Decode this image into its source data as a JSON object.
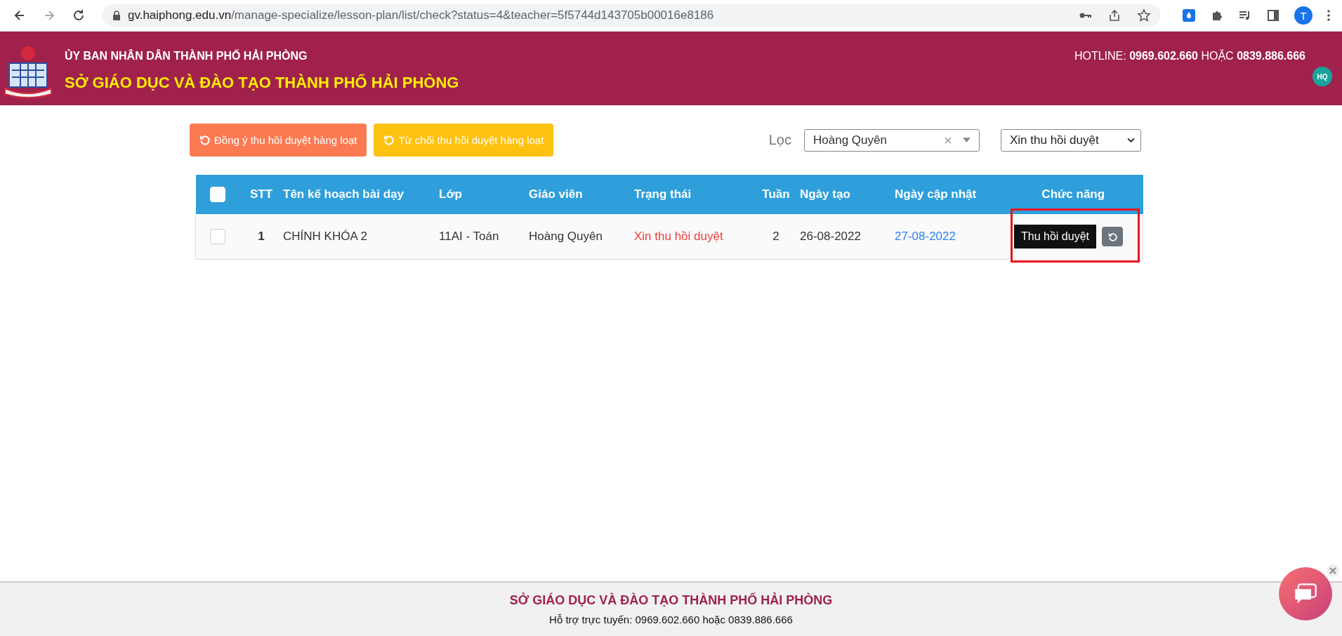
{
  "browser": {
    "url_host": "gv.haiphong.edu.vn",
    "url_path": "/manage-specialize/lesson-plan/list/check?status=4&teacher=5f5744d143705b00016e8186",
    "profile_initial": "T"
  },
  "header": {
    "subtitle": "ỦY BAN NHÂN DÂN THÀNH PHỐ HẢI PHÒNG",
    "title": "SỞ GIÁO DỤC VÀ ĐÀO TẠO THÀNH PHỐ HẢI PHÒNG",
    "hotline": "HOTLINE: **0969.602.660** HOẶC **0839.886.666**",
    "avatar": "HQ"
  },
  "actions": [
    {
      "label": "Đồng ý thu hồi duyệt hàng loạt",
      "kind": "approve"
    },
    {
      "label": "Từ chối thu hồi duyệt hàng loạt",
      "kind": "reject"
    }
  ],
  "filter": {
    "label": "Lọc",
    "teacher": "Hoàng Quyên",
    "status": "Xin thu hồi duyệt"
  },
  "table": {
    "columns": [
      "STT",
      "Tên kế hoạch bài dạy",
      "Lớp",
      "Giáo viên",
      "Trạng thái",
      "Tuần",
      "Ngày tạo",
      "Ngày cập nhật",
      "Chức năng"
    ],
    "all_checked": false,
    "rows": [
      {
        "checked": false,
        "cells": [
          "1",
          "CHÍNH KHÓA 2",
          "11AI - Toán",
          "Hoàng Quyên",
          "Xin thu hồi duyệt",
          "2",
          "26-08-2022",
          "27-08-2022"
        ],
        "tooltip": "Thu hồi duyệt",
        "highlighted": true
      }
    ]
  },
  "footer": {
    "title": "SỞ GIÁO DỤC VÀ ĐÀO TẠO THÀNH PHỐ HẢI PHÒNG",
    "support": "Hỗ trợ trực tuyến: 0969.602.660 hoặc 0839.886.666"
  }
}
